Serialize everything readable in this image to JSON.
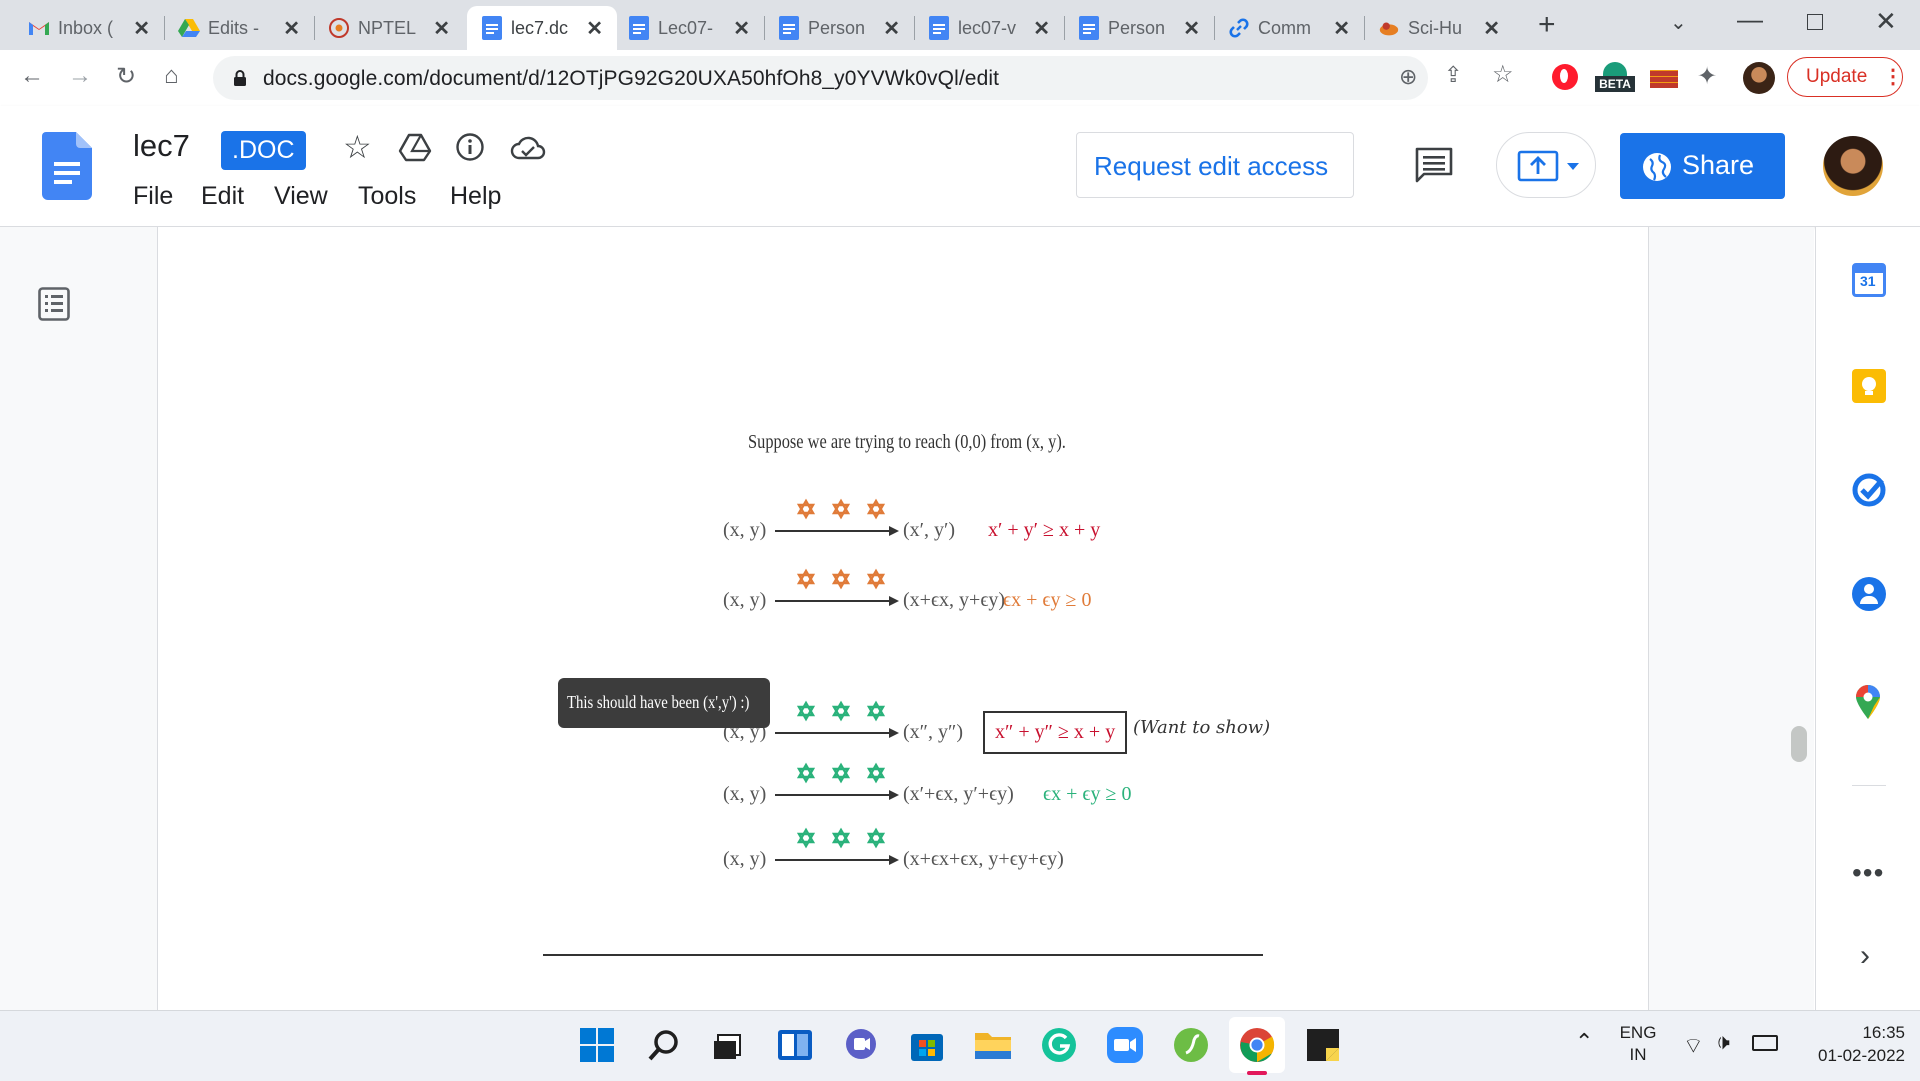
{
  "browser": {
    "tabs": [
      {
        "title": "Inbox (",
        "icon": "gmail-icon"
      },
      {
        "title": "Edits -",
        "icon": "google-drive-icon"
      },
      {
        "title": "NPTEL",
        "icon": "nptel-icon"
      },
      {
        "title": "lec7.dc",
        "icon": "google-docs-icon",
        "active": true
      },
      {
        "title": "Lec07-",
        "icon": "google-docs-icon"
      },
      {
        "title": "Person",
        "icon": "google-docs-icon"
      },
      {
        "title": "lec07-v",
        "icon": "google-docs-icon"
      },
      {
        "title": "Person",
        "icon": "google-docs-icon"
      },
      {
        "title": "Comm",
        "icon": "link-icon"
      },
      {
        "title": "Sci-Hu",
        "icon": "scihub-icon"
      }
    ],
    "url": "docs.google.com/document/d/12OTjPG92G20UXA50hfOh8_y0YVWk0vQl/edit",
    "beta_label": "BETA",
    "update_label": "Update"
  },
  "docs": {
    "title": "lec7",
    "file_badge": ".DOC",
    "menu": [
      "File",
      "Edit",
      "View",
      "Tools",
      "Help"
    ],
    "request_edit_label": "Request edit access",
    "share_label": "Share",
    "calendar_day": "31"
  },
  "slide": {
    "intro": "Suppose we are trying to reach (0,0) from (x, y).",
    "comment": "This should have been (x',y') :)",
    "rows": [
      {
        "from": "(x, y)",
        "to": "(x′, y′)",
        "condition": "x′ + y′ ≥ x + y",
        "star_color": "#e07b39",
        "cond_color": "#c8102e"
      },
      {
        "from": "(x, y)",
        "to": "(x+ϵx, y+ϵy)",
        "condition": "ϵx + ϵy ≥ 0",
        "star_color": "#e07b39",
        "cond_color": "#e07b39"
      },
      {
        "from": "(x, y)",
        "to": "(x″, y″)",
        "condition": "x″ + y″ ≥ x + y",
        "note": "(Want to show)",
        "star_color": "#2ab27b",
        "cond_color": "#c8102e"
      },
      {
        "from": "(x, y)",
        "to": "(x′+ϵx, y′+ϵy)",
        "condition": "ϵx + ϵy ≥ 0",
        "star_color": "#2ab27b",
        "cond_color": "#2ab27b"
      },
      {
        "from": "(x, y)",
        "to": "(x+ϵx+ϵx, y+ϵy+ϵy)",
        "condition": "",
        "star_color": "#2ab27b",
        "cond_color": "#2ab27b"
      }
    ]
  },
  "taskbar": {
    "lang_1": "ENG",
    "lang_2": "IN",
    "time": "16:35",
    "date": "01-02-2022"
  }
}
